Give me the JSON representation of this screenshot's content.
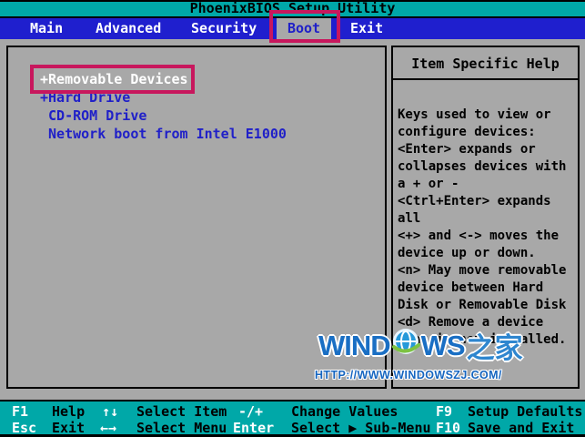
{
  "title": "PhoenixBIOS Setup Utility",
  "menu": {
    "items": [
      {
        "label": "Main",
        "selected": false
      },
      {
        "label": "Advanced",
        "selected": false
      },
      {
        "label": "Security",
        "selected": false
      },
      {
        "label": "Boot",
        "selected": true
      },
      {
        "label": "Exit",
        "selected": false
      }
    ]
  },
  "boot_list": {
    "items": [
      {
        "label": "+Removable Devices",
        "selected": true
      },
      {
        "label": "+Hard Drive",
        "selected": false
      },
      {
        "label": " CD-ROM Drive",
        "selected": false
      },
      {
        "label": " Network boot from Intel E1000",
        "selected": false
      }
    ]
  },
  "help_panel": {
    "title": "Item Specific Help",
    "lines": [
      "Keys used to view or",
      "configure devices:",
      "<Enter> expands or",
      "collapses devices with",
      "a + or -",
      "<Ctrl+Enter> expands",
      "all",
      "<+> and <-> moves the",
      "device up or down.",
      "<n> May move removable",
      "device between Hard",
      "Disk or Removable Disk",
      "<d> Remove a device",
      "that is not installed."
    ]
  },
  "footer": {
    "row1": [
      {
        "key": "F1",
        "label": "Help"
      },
      {
        "key": "↑↓",
        "label": "Select Item"
      },
      {
        "key": "-/+",
        "label": "Change Values"
      },
      {
        "key": "F9",
        "label": "Setup Defaults"
      }
    ],
    "row2": [
      {
        "key": "Esc",
        "label": "Exit"
      },
      {
        "key": "←→",
        "label": "Select Menu"
      },
      {
        "key": "Enter",
        "label": "Select ▶ Sub-Menu"
      },
      {
        "key": "F10",
        "label": "Save and Exit"
      }
    ]
  },
  "watermark": {
    "logo_part1": "WIND",
    "logo_part2": "WS",
    "logo_part3": "之家",
    "url": "HTTP://WWW.WINDOWSZJ.COM/"
  },
  "annotations": {
    "boot_tab_box": "highlight around Boot tab",
    "removable_box": "highlight around +Removable Devices"
  },
  "colors": {
    "teal_bar": "#00A8A8",
    "menu_blue": "#1F1FCE",
    "background_gray": "#A8A8A8",
    "item_blue": "#2020C8",
    "selected_item_white": "#FFFFFF",
    "annotation_red": "#C8175D",
    "watermark_blue": "#1A6FC4"
  }
}
